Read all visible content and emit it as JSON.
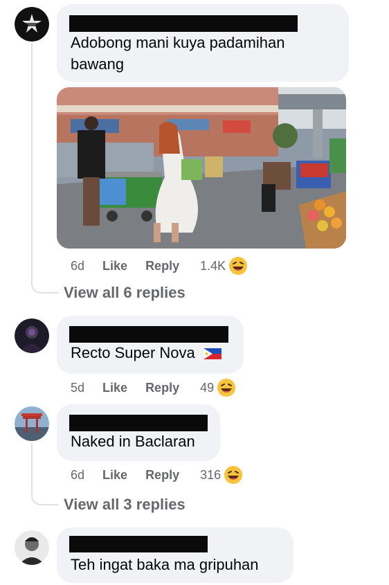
{
  "comments": [
    {
      "text": "Adobong mani kuya padamihan bawang",
      "time": "6d",
      "like": "Like",
      "reply": "Reply",
      "reaction_count": "1.4K",
      "reaction_icon": "haha-emoji-icon",
      "view_replies": "View all 6 replies"
    },
    {
      "text": "Recto Super Nova",
      "time": "5d",
      "like": "Like",
      "reply": "Reply",
      "reaction_count": "49",
      "reaction_icon": "haha-emoji-icon",
      "flag_icon": "philippines-flag-icon"
    },
    {
      "text": "Naked in Baclaran",
      "time": "6d",
      "like": "Like",
      "reply": "Reply",
      "reaction_count": "316",
      "reaction_icon": "haha-emoji-icon",
      "view_replies": "View all 3 replies"
    },
    {
      "text": "Teh ingat baka ma gripuhan"
    }
  ],
  "colors": {
    "bubble": "#f0f2f5",
    "meta_text": "#65676b",
    "redaction": "#0a0a0a",
    "thread_line": "#dfe1e5"
  }
}
